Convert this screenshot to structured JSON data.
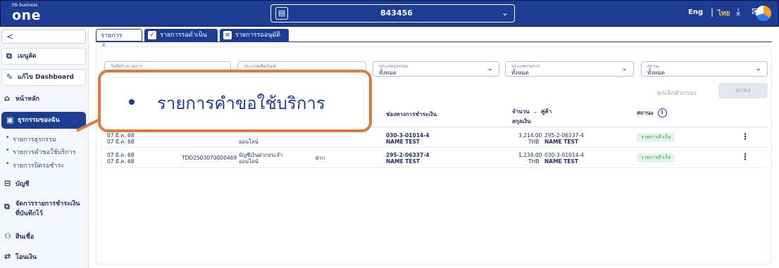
{
  "topbar": {
    "logo_small": "ttb business",
    "logo_big": "one",
    "account_icon": "bank-book-icon",
    "account_number": "843456",
    "lang_en": "Eng",
    "lang_th": "ไทย",
    "download_icon": "download-icon",
    "mail_icon": "mail-icon",
    "colors": {
      "bar": "#1d3d95",
      "active_lang": "#f5c842"
    }
  },
  "sidebar": {
    "collapse": "<",
    "items": [
      {
        "label": "เมนูลัด",
        "icon": "shortcut-icon"
      },
      {
        "label": "แก้ไข Dashboard",
        "icon": "edit-icon"
      },
      {
        "label": "หน้าหลัก",
        "icon": "home-icon"
      },
      {
        "label": "ธุรกรรมของฉัน",
        "icon": "transaction-icon"
      }
    ],
    "sub_items": [
      "รายการธุรกรรม",
      "รายการคำขอใช้บริการ",
      "รายการปิดรอชำระ"
    ],
    "lower_items": [
      {
        "label": "บัญชี",
        "icon": "account-icon"
      },
      {
        "label": "จัดการรายการชำระเงิน",
        "label2": "ที่บันทึกไว้",
        "icon": "saved-payments-icon"
      },
      {
        "label": "สินเชื่อ",
        "icon": "loan-icon"
      },
      {
        "label": "โอนเงิน",
        "icon": "transfer-icon"
      }
    ]
  },
  "tabs": [
    {
      "label": "รายการทั้งหมด"
    },
    {
      "label": "รายการรอดำเนินการ",
      "icon": "checklist-icon"
    },
    {
      "label": "รายการรออนุมัติ",
      "icon": "document-icon"
    }
  ],
  "filters": [
    {
      "label": "วันที่สร้างรายการ",
      "value": ""
    },
    {
      "label": "ประเภทผลิตภัณฑ์",
      "value": ""
    },
    {
      "label": "ประเภทธุรกรรม",
      "value": "ทั้งหมด"
    },
    {
      "label": "ประเภทรายการ",
      "value": "ทั้งหมด"
    },
    {
      "label": "สถานะ",
      "value": "ทั้งหมด"
    }
  ],
  "actions": {
    "clear": "ยกเลิกตัวกรอง",
    "ok": "ตกลง"
  },
  "table": {
    "headers": {
      "channel": "ช่องทางการชำระเงิน",
      "amount": "จำนวน",
      "amount2": "สกุลเงิน",
      "counterparty": "คู่ค้า",
      "status": "สถานะ"
    },
    "rows": [
      {
        "date1": "07 มี.ค. 68",
        "date2": "07 มี.ค. 68",
        "ref": "",
        "product1": "",
        "product2": "ออนไลน์",
        "type": "",
        "channel_acct": "030-3-01014-4",
        "channel_name": "NAME TEST",
        "amount": "3,214.00",
        "currency": "THB",
        "cp_acct": "295-2-06337-4",
        "cp_name": "NAME TEST",
        "status": "รายการสำเร็จ"
      },
      {
        "date1": "07 มี.ค. 68",
        "date2": "07 มี.ค. 68",
        "ref": "TDD2503070000469",
        "product1": "บัญชีเงินฝากประจำ",
        "product2": "ออนไลน์",
        "type": "ฝาก",
        "channel_acct": "295-2-06337-4",
        "channel_name": "NAME TEST",
        "amount": "1,234.00",
        "currency": "THB",
        "cp_acct": "030-3-01014-4",
        "cp_name": "NAME TEST",
        "status": "รายการสำเร็จ"
      }
    ]
  },
  "callout": {
    "text": "รายการคำขอใช้บริการ",
    "color": "#e07a36"
  }
}
